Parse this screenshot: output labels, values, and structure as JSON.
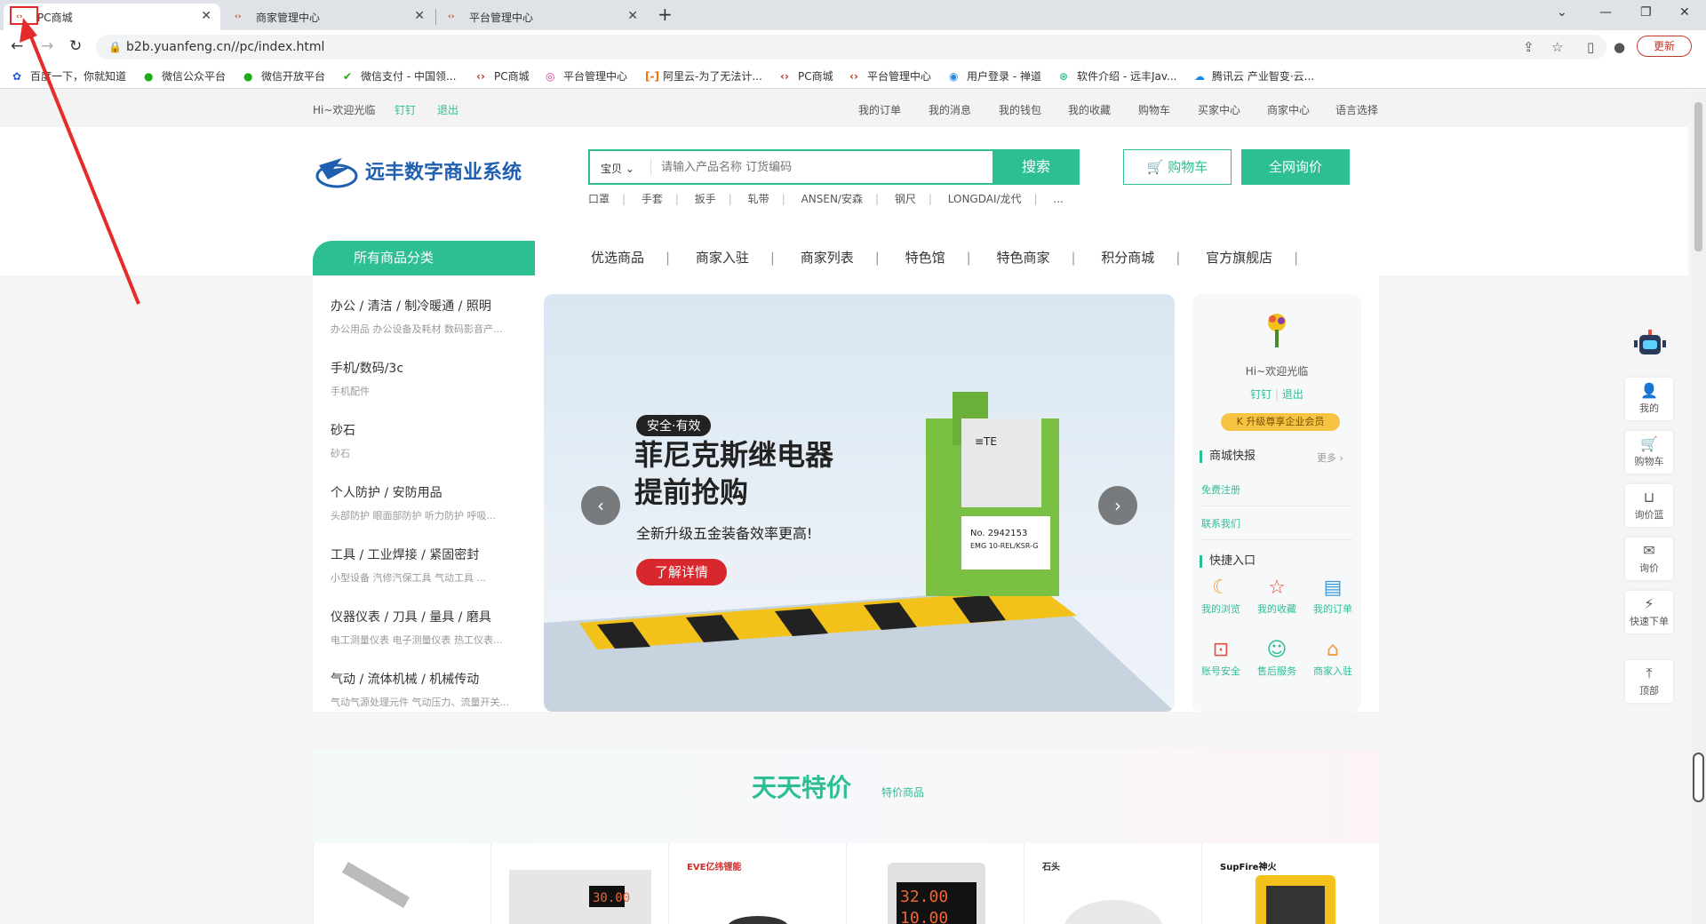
{
  "browser": {
    "tabs": [
      {
        "label": "PC商城",
        "active": true
      },
      {
        "label": "商家管理中心",
        "active": false
      },
      {
        "label": "平台管理中心",
        "active": false
      }
    ],
    "url": "b2b.yuanfeng.cn//pc/index.html",
    "update_label": "更新",
    "bookmarks": [
      "百度一下，你就知道",
      "微信公众平台",
      "微信开放平台",
      "微信支付 - 中国领...",
      "PC商城",
      "平台管理中心",
      "阿里云-为了无法计...",
      "PC商城",
      "平台管理中心",
      "用户登录 - 禅道",
      "软件介绍 - 远丰Jav...",
      "腾讯云 产业智变·云..."
    ]
  },
  "topbar": {
    "greeting": "Hi~欢迎光临",
    "dingding": "钉钉",
    "logout": "退出",
    "links": [
      "我的订单",
      "我的消息",
      "我的钱包",
      "我的收藏",
      "购物车",
      "买家中心",
      "商家中心",
      "语言选择"
    ]
  },
  "header": {
    "logo_text": "远丰数字商业系统",
    "search_scope": "宝贝",
    "search_placeholder": "请输入产品名称 订货编码",
    "search_button": "搜索",
    "hotwords": [
      "口罩",
      "手套",
      "扳手",
      "轧带",
      "ANSEN/安森",
      "钢尺",
      "LONGDAI/龙代",
      "..."
    ],
    "cart_label": "购物车",
    "ask_label": "全网询价"
  },
  "nav": {
    "category_tab": "所有商品分类",
    "items": [
      "优选商品",
      "商家入驻",
      "商家列表",
      "特色馆",
      "特色商家",
      "积分商城",
      "官方旗舰店"
    ]
  },
  "categories": [
    {
      "name": "办公 / 清洁 / 制冷暖通 / 照明",
      "sub": "办公用品  办公设备及耗材  数码影音产..."
    },
    {
      "name": "手机/数码/3c",
      "sub": "手机配件"
    },
    {
      "name": "砂石",
      "sub": "砂石"
    },
    {
      "name": "个人防护 / 安防用品",
      "sub": "头部防护  眼面部防护  听力防护  呼吸..."
    },
    {
      "name": "工具 / 工业焊接 / 紧固密封",
      "sub": "小型设备  汽修汽保工具  气动工具  ..."
    },
    {
      "name": "仪器仪表 / 刀具 / 量具 / 磨具",
      "sub": "电工测量仪表  电子测量仪表  热工仪表..."
    },
    {
      "name": "气动 / 流体机械 / 机械传动",
      "sub": "气动气源处理元件  气动压力、流量开关..."
    }
  ],
  "banner": {
    "tag": "安全·有效",
    "title_line1": "菲尼克斯继电器",
    "title_line2": "提前抢购",
    "subtitle": "全新升级五金装备效率更高!",
    "button": "了解详情",
    "prev_icon": "chevron-left-icon",
    "next_icon": "chevron-right-icon"
  },
  "userpanel": {
    "greeting": "Hi~欢迎光临",
    "dingding": "钉钉",
    "logout": "退出",
    "vip": "升级尊享企业会员",
    "news_title": "商城快报",
    "more": "更多",
    "news": [
      "免费注册",
      "联系我们"
    ],
    "quick_title": "快捷入口",
    "quick": [
      {
        "label": "我的浏览",
        "icon": "browse-icon"
      },
      {
        "label": "我的收藏",
        "icon": "star-icon"
      },
      {
        "label": "我的订单",
        "icon": "order-icon"
      },
      {
        "label": "账号安全",
        "icon": "lock-icon"
      },
      {
        "label": "售后服务",
        "icon": "service-icon"
      },
      {
        "label": "商家入驻",
        "icon": "store-icon"
      }
    ]
  },
  "sidebar": [
    {
      "label": "我的",
      "icon": "user-icon"
    },
    {
      "label": "购物车",
      "icon": "cart-icon"
    },
    {
      "label": "询价篮",
      "icon": "basket-icon"
    },
    {
      "label": "询价",
      "icon": "chat-icon"
    },
    {
      "label": "快速下单",
      "icon": "quick-order-icon"
    },
    {
      "label": "顶部",
      "icon": "top-icon"
    }
  ],
  "deals": {
    "title": "天天特价",
    "subtitle": "特价商品",
    "brands": [
      "EVE亿纬锂能",
      "石头",
      "SupFire神火"
    ]
  },
  "colors": {
    "accent": "#2dbf92",
    "banner_button": "#d9272e",
    "annotation": "#e52b2b"
  }
}
